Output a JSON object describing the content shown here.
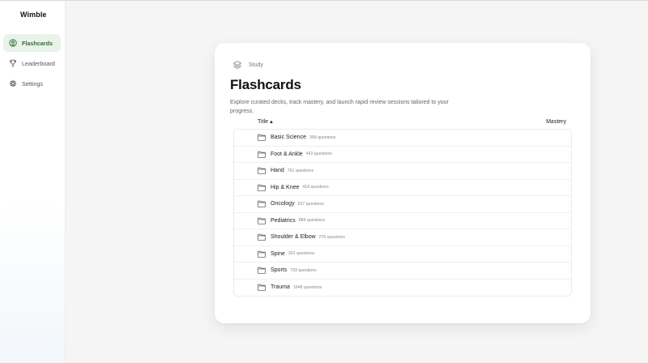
{
  "app": {
    "brand": "Wimble"
  },
  "sidebar": {
    "items": [
      {
        "label": "Flashcards",
        "icon": "brain-icon",
        "active": true
      },
      {
        "label": "Leaderboard",
        "icon": "trophy-icon",
        "active": false
      },
      {
        "label": "Settings",
        "icon": "gear-icon",
        "active": false
      }
    ]
  },
  "main": {
    "breadcrumb": "Study",
    "title": "Flashcards",
    "description": "Explore curated decks, track mastery, and launch rapid review sessions tailored to your progress.",
    "columns": {
      "title": "Title",
      "sort_arrow": "▲",
      "mastery": "Mastery"
    },
    "decks": [
      {
        "name": "Basic Science",
        "count": "368 questions"
      },
      {
        "name": "Foot & Ankle",
        "count": "443 questions"
      },
      {
        "name": "Hand",
        "count": "761 questions"
      },
      {
        "name": "Hip & Knee",
        "count": "418 questions"
      },
      {
        "name": "Oncology",
        "count": "537 questions"
      },
      {
        "name": "Pediatrics",
        "count": "889 questions"
      },
      {
        "name": "Shoulder & Elbow",
        "count": "276 questions"
      },
      {
        "name": "Spine",
        "count": "301 questions"
      },
      {
        "name": "Sports",
        "count": "793 questions"
      },
      {
        "name": "Trauma",
        "count": "1648 questions"
      }
    ]
  },
  "colors": {
    "accent": "#2f6f33",
    "accent_bg": "#e9f3ea"
  }
}
